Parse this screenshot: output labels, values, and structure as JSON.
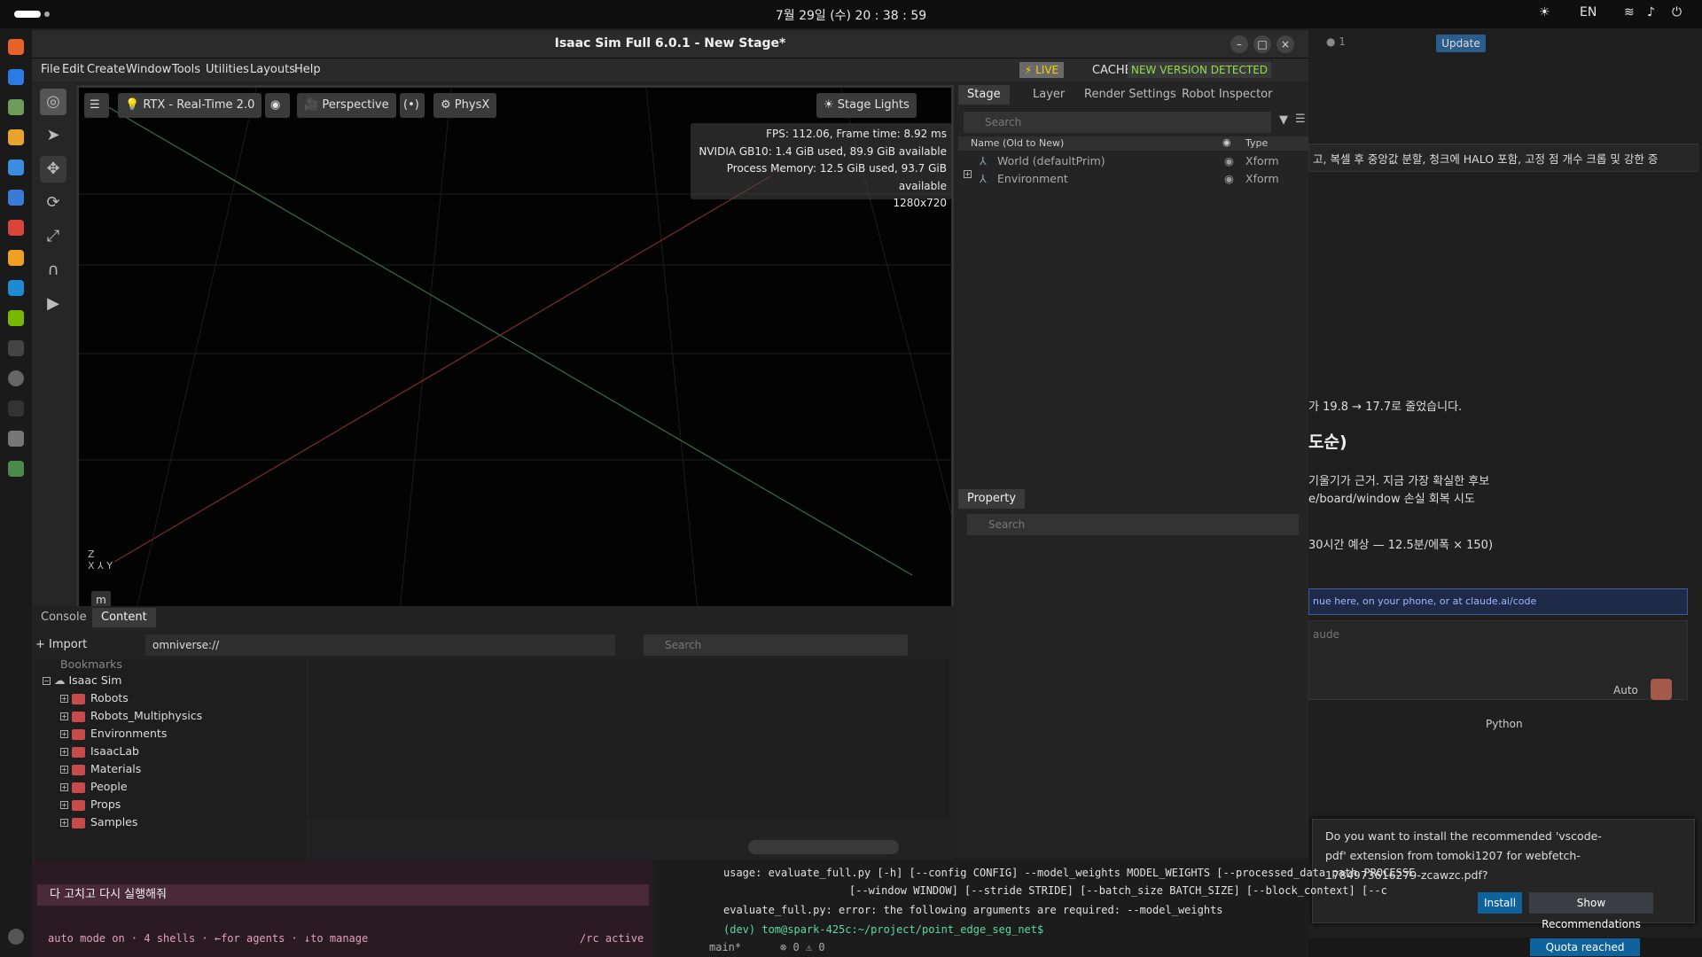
{
  "system": {
    "clock": "7월 29일 (수)  20 : 38 : 59",
    "lang": "EN"
  },
  "isaac": {
    "title": "Isaac Sim Full 6.0.1 - New Stage*",
    "menu": [
      "File",
      "Edit",
      "Create",
      "Window",
      "Tools",
      "Utilities",
      "Layouts",
      "Help"
    ],
    "live": "LIVE",
    "cache_label": "CACHE:",
    "cache_status": "NEW VERSION DETECTED",
    "viewport": {
      "renderer": "RTX - Real-Time 2.0",
      "camera": "Perspective",
      "physx": "PhysX",
      "stage_lights": "Stage Lights",
      "stats": [
        "FPS: 112.06, Frame time: 8.92 ms",
        "NVIDIA GB10: 1.4 GiB used, 89.9 GiB available",
        "Process Memory: 12.5 GiB used, 93.7 GiB available",
        "1280x720"
      ],
      "unit": "m"
    },
    "stage": {
      "tabs": [
        "Stage",
        "Layer",
        "Render Settings",
        "Robot Inspector"
      ],
      "search": "Search",
      "col_name": "Name (Old to New)",
      "col_type": "Type",
      "rows": [
        {
          "name": "World (defaultPrim)",
          "type": "Xform"
        },
        {
          "name": "Environment",
          "type": "Xform"
        }
      ]
    },
    "property": {
      "tab": "Property",
      "search": "Search"
    },
    "bottom": {
      "tabs": [
        "Console",
        "Content"
      ],
      "import": "Import",
      "path": "omniverse://",
      "search": "Search",
      "bookmarks": "Bookmarks",
      "root": "Isaac Sim",
      "folders": [
        "Robots",
        "Robots_Multiphysics",
        "Environments",
        "IsaacLab",
        "Materials",
        "People",
        "Props",
        "Samples"
      ]
    }
  },
  "vscode": {
    "update": "Update",
    "chat_line1": "고, 복셀 후 중앙값 분할, 청크에 HALO 포함, 고정 점 개수 크롭 및 강한 증",
    "chat_line2": "가 19.8 → 17.7로 줄었습니다.",
    "chat_heading": "도순)",
    "chat_line3": "기울기가 근거. 지금 가장 확실한 후보",
    "chat_line4": "e/board/window 손실 회복 시도",
    "chat_line5": "30시간 예상 — 12.5분/에폭 × 150)",
    "banner": "nue here, on your phone, or at claude.ai/code",
    "input_placeholder": "aude",
    "auto": "Auto",
    "python": "Python",
    "notification": "Do you want to install the recommended 'vscode-pdf' extension from tomoki1207 for webfetch-1784973616279-zcawzc.pdf?",
    "install": "Install",
    "show_rec": "Show Recommendations",
    "quota": "Quota reached"
  },
  "terminal": {
    "usage1": "usage: evaluate_full.py [-h] [--config CONFIG] --model_weights MODEL_WEIGHTS [--processed_data_path PROCESSE",
    "usage2": "[--window WINDOW] [--stride STRIDE] [--batch_size BATCH_SIZE] [--block_context] [--c",
    "error": "evaluate_full.py: error: the following arguments are required: --model_weights",
    "prompt": "(dev) tom@spark-425c:~/project/point_edge_seg_net$",
    "branch": "main*",
    "errors": "0",
    "warnings": "0"
  },
  "claude_term": {
    "input": "다 고치고 다시 실행해줘",
    "status": "auto mode on · 4 shells · ←for agents · ↓to manage",
    "rc": "/rc active"
  }
}
